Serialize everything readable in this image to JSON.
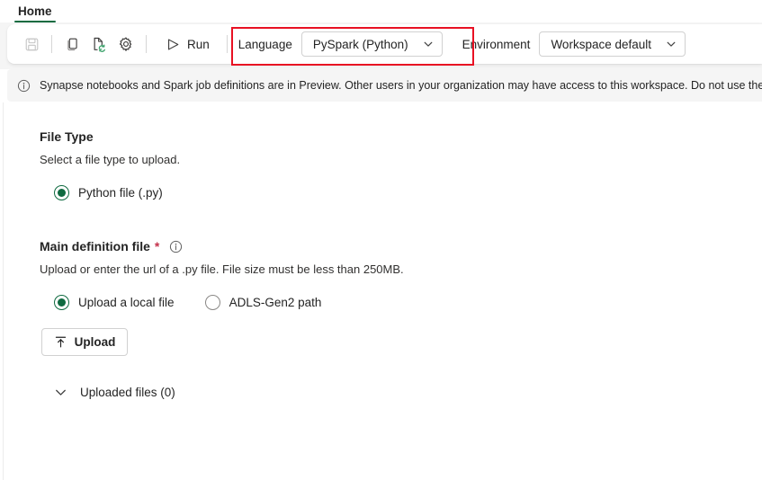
{
  "ribbon": {
    "tabs": [
      {
        "label": "Home",
        "active": true
      }
    ]
  },
  "toolbar": {
    "icons": [
      {
        "name": "save-icon",
        "title": "Save",
        "disabled": true
      },
      {
        "name": "copy-icon",
        "title": "Copy",
        "disabled": false
      },
      {
        "name": "document-refresh-icon",
        "title": "Refresh",
        "disabled": false
      },
      {
        "name": "gear-icon",
        "title": "Settings",
        "disabled": false
      }
    ],
    "run_label": "Run",
    "language": {
      "label": "Language",
      "value": "PySpark (Python)"
    },
    "environment": {
      "label": "Environment",
      "value": "Workspace default"
    },
    "highlight_color": "#e81123"
  },
  "banner": {
    "icon": "info-icon",
    "text": "Synapse notebooks and Spark job definitions are in Preview. Other users in your organization may have access to this workspace. Do not use these items"
  },
  "file_type": {
    "title": "File Type",
    "description": "Select a file type to upload.",
    "options": [
      {
        "label": "Python file (.py)",
        "checked": true
      }
    ]
  },
  "main_definition_file": {
    "title": "Main definition file",
    "required_marker": "*",
    "info_icon": "info-icon",
    "description": "Upload or enter the url of a .py file. File size must be less than 250MB.",
    "options": [
      {
        "label": "Upload a local file",
        "checked": true
      },
      {
        "label": "ADLS-Gen2 path",
        "checked": false
      }
    ],
    "upload_button": {
      "label": "Upload",
      "icon": "upload-arrow-icon"
    },
    "uploaded_files": {
      "label": "Uploaded files (0)",
      "icon": "chevron-down-icon",
      "expanded": false
    }
  },
  "theme": {
    "accent_green": "#0f6a40",
    "required_red": "#c4314b",
    "highlight_red": "#e81123",
    "band_gray": "#f5f5f5"
  }
}
